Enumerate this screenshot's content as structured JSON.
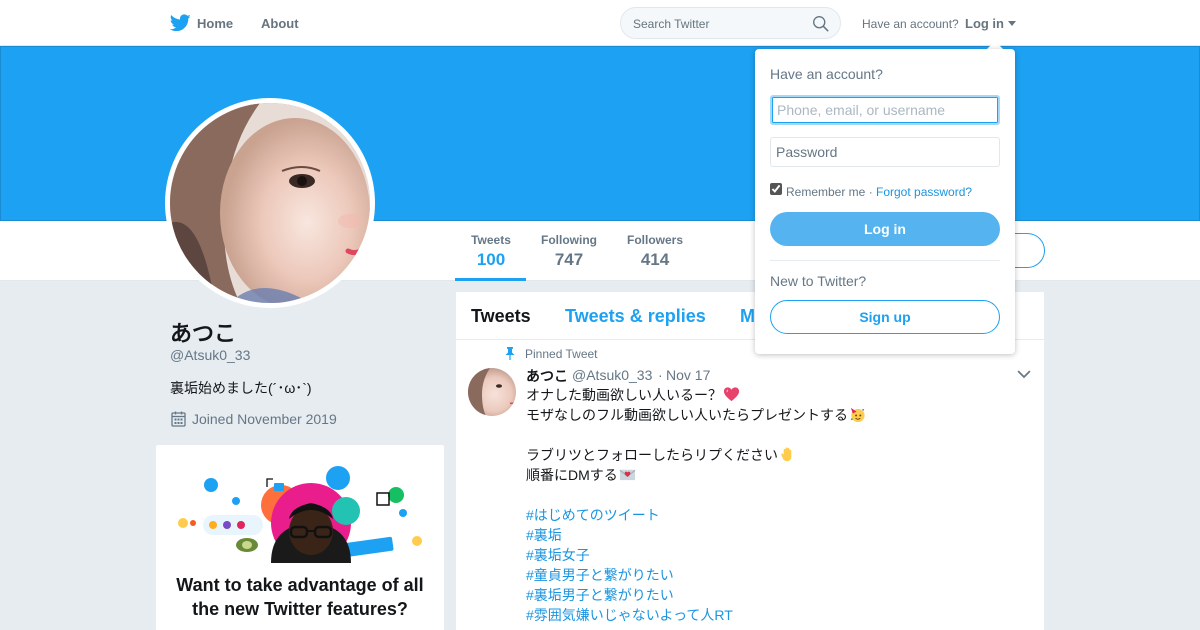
{
  "nav": {
    "home_label": "Home",
    "about_label": "About",
    "search_placeholder": "Search Twitter",
    "have_account": "Have an account?",
    "login_label": "Log in"
  },
  "profile": {
    "name": "あつこ",
    "handle": "@Atsuk0_33",
    "bio": "裏垢始めました(´･ω･`)",
    "joined": "Joined November 2019"
  },
  "stats": [
    {
      "label": "Tweets",
      "value": "100"
    },
    {
      "label": "Following",
      "value": "747"
    },
    {
      "label": "Followers",
      "value": "414"
    }
  ],
  "promo": {
    "title": "Want to take advantage of all the new Twitter features?"
  },
  "timeline": {
    "tabs": [
      "Tweets",
      "Tweets & replies",
      "M"
    ],
    "pinned_label": "Pinned Tweet",
    "tweet": {
      "name": "あつこ",
      "handle": "@Atsuk0_33",
      "dot": "·",
      "date": "Nov 17",
      "lines": [
        "オナした動画欲しい人いるー？",
        "モザなしのフル動画欲しい人いたらプレゼントする",
        "",
        "ラブリツとフォローしたらリプください",
        "順番にDMする"
      ],
      "hashtags": [
        "#はじめてのツイート",
        "#裏垢",
        "#裏垢女子",
        "#童貞男子と繋がりたい",
        "#裏垢男子と繋がりたい",
        "#雰囲気嫌いじゃないよって人RT"
      ]
    }
  },
  "login_dropdown": {
    "title": "Have an account?",
    "username_placeholder": "Phone, email, or username",
    "password_placeholder": "Password",
    "remember_label": "Remember me ·",
    "forgot_label": "Forgot password?",
    "login_button": "Log in",
    "new_label": "New to Twitter?",
    "signup_button": "Sign up"
  },
  "colors": {
    "brand": "#1da1f2",
    "link": "#1b95e0",
    "muted": "#657786",
    "background": "#e6ecf0"
  }
}
